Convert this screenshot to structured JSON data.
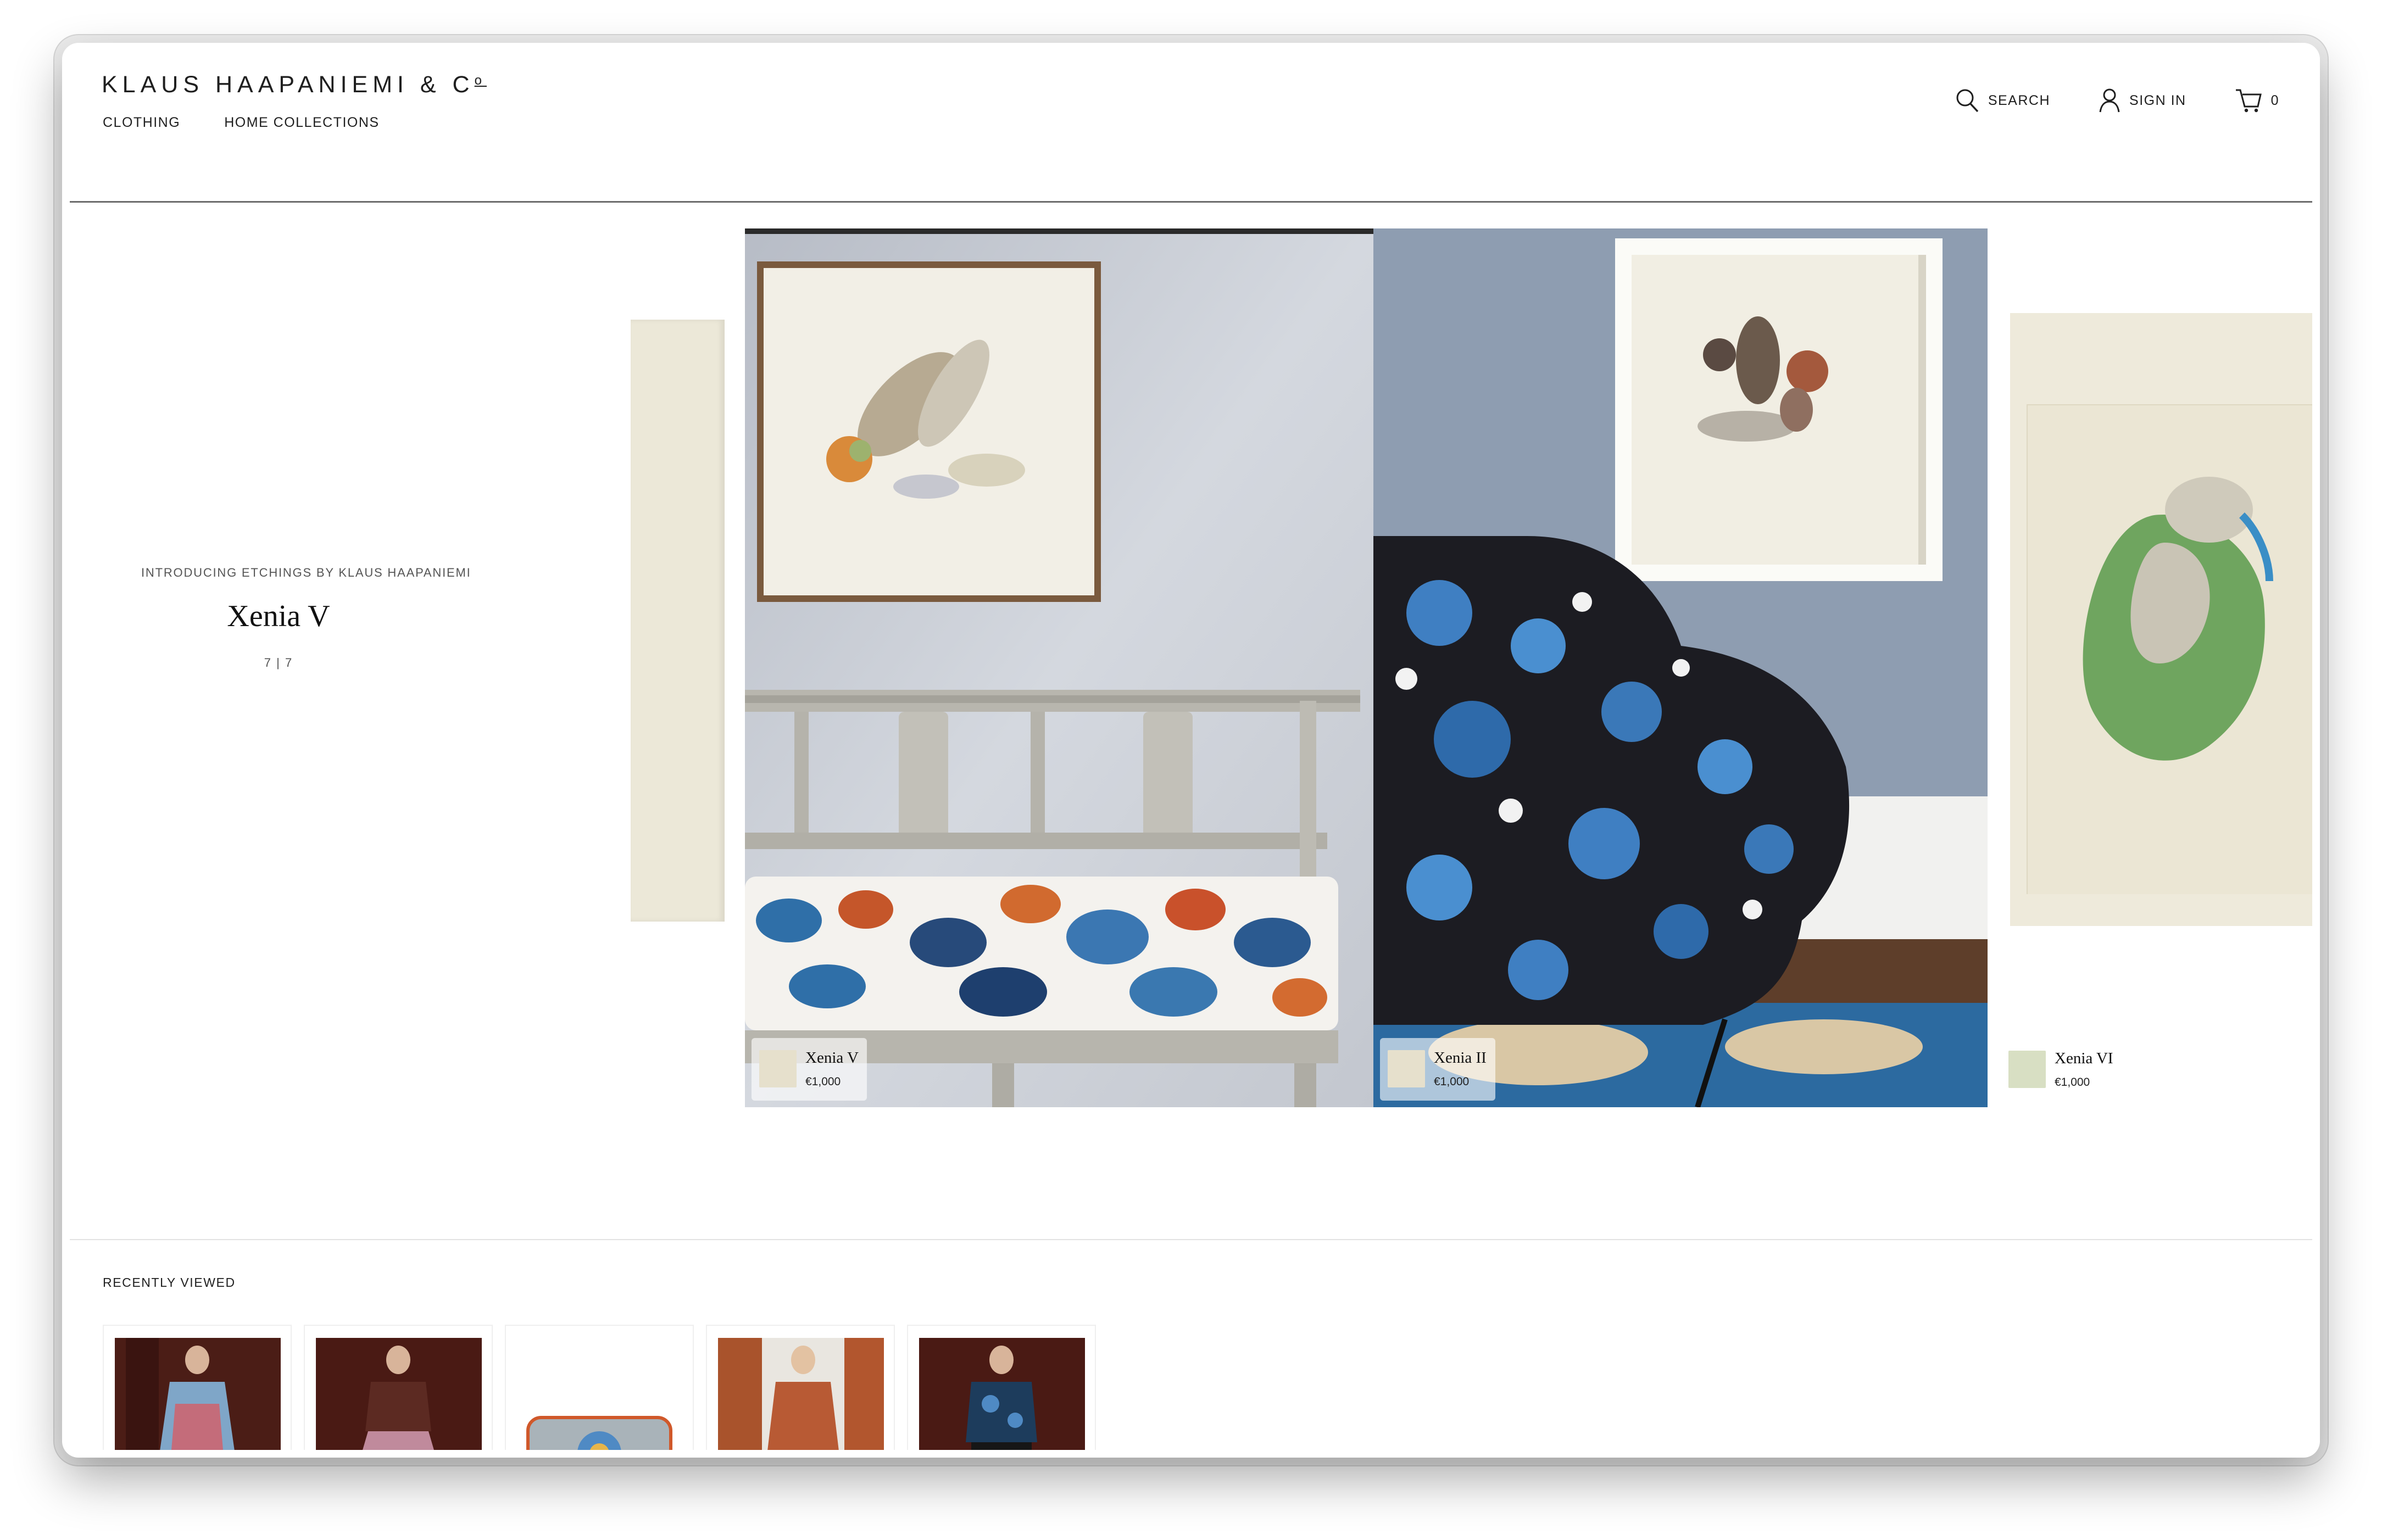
{
  "brand": {
    "logo_text": "KLAUS HAAPANIEMI &amp; C",
    "logo_sup": "o"
  },
  "nav": {
    "items": [
      "CLOTHING",
      "HOME COLLECTIONS"
    ]
  },
  "tools": {
    "search": "SEARCH",
    "sign_in": "SIGN IN",
    "cart_count": "0"
  },
  "hero": {
    "kicker": "INTRODUCING ETCHINGS BY KLAUS HAAPANIEMI",
    "title": "Xenia V",
    "counter": "7 | 7"
  },
  "slides": [
    {
      "name": "Xenia V",
      "price": "€1,000"
    },
    {
      "name": "Xenia II",
      "price": "€1,000"
    },
    {
      "name": "Xenia VI",
      "price": "€1,000"
    }
  ],
  "recently_viewed": {
    "title": "RECENTLY VIEWED",
    "count": 5
  },
  "colors": {
    "text": "#1f1f1f",
    "divider": "#6d6d6d",
    "accent_blue": "#2f6fa8"
  }
}
